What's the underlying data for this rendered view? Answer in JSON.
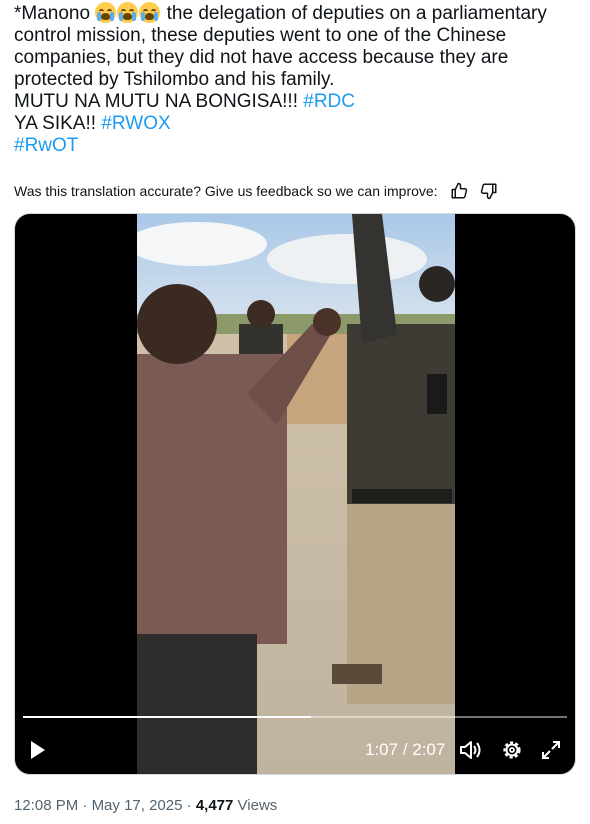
{
  "tweet": {
    "line1_prefix": "*Manono",
    "line1_suffix": "the delegation of deputies on a parliamentary",
    "line2": "control mission, these deputies went to one of the Chinese",
    "line3": "companies, but they did not have access because they are",
    "line4": "protected by Tshilombo and his family.",
    "line5_text": "MUTU NA MUTU NA BONGISA!!!",
    "hashtag_rdc": "#RDC",
    "line6_text": "YA SIKA!!",
    "hashtag_rwox": "#RWOX",
    "hashtag_rwot": "#RwOT",
    "emoji_name": "loudly-crying-face",
    "hashtag_color": "#1d9bf0"
  },
  "feedback": {
    "prompt": "Was this translation accurate? Give us feedback so we can improve:",
    "thumbs_up_icon": "thumbs-up-icon",
    "thumbs_down_icon": "thumbs-down-icon"
  },
  "video": {
    "current_time": "1:07",
    "duration": "2:07",
    "time_display": "1:07 / 2:07",
    "progress_fraction": 0.53,
    "play_icon": "play-icon",
    "volume_icon": "volume-icon",
    "settings_icon": "gear-icon",
    "fullscreen_icon": "expand-icon"
  },
  "meta": {
    "time": "12:08 PM",
    "date": "May 17, 2025",
    "views_count": "4,477",
    "views_label": "Views",
    "secondary_color": "#536471"
  }
}
